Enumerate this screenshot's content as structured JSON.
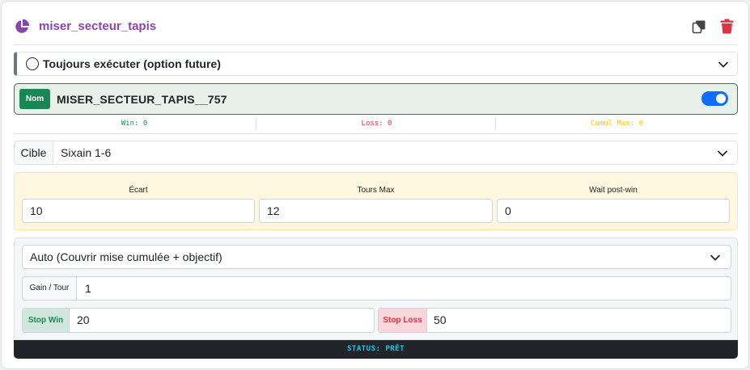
{
  "header": {
    "title": "miser_secteur_tapis",
    "accent_color": "#8b44ac",
    "icons": [
      "pie-chart-icon",
      "copy-icon",
      "trash-icon"
    ]
  },
  "trigger": {
    "label": "Toujours exécuter (option future)"
  },
  "name": {
    "badge": "Nom",
    "value": "MISER_SECTEUR_TAPIS__757",
    "enabled": true
  },
  "stats": {
    "win": "Win: 0",
    "loss": "Loss: 0",
    "cumul": "Cumul Max: 0"
  },
  "target": {
    "label": "Cible",
    "value": "Sixain 1-6"
  },
  "params": [
    {
      "label": "Écart",
      "value": "10"
    },
    {
      "label": "Tours Max",
      "value": "12"
    },
    {
      "label": "Wait post-win",
      "value": "0"
    }
  ],
  "mode": {
    "value": "Auto (Couvrir mise cumulée + objectif)"
  },
  "gain": {
    "label": "Gain / Tour",
    "value": "1"
  },
  "stop_win": {
    "label": "Stop Win",
    "value": "20"
  },
  "stop_loss": {
    "label": "Stop Loss",
    "value": "50"
  },
  "status": {
    "text": "STATUS: PRÊT"
  },
  "colors": {
    "success": "#198754",
    "danger": "#dc3545",
    "warning": "#ffc107",
    "info": "#0dcaf0",
    "primary": "#0d6efd"
  }
}
